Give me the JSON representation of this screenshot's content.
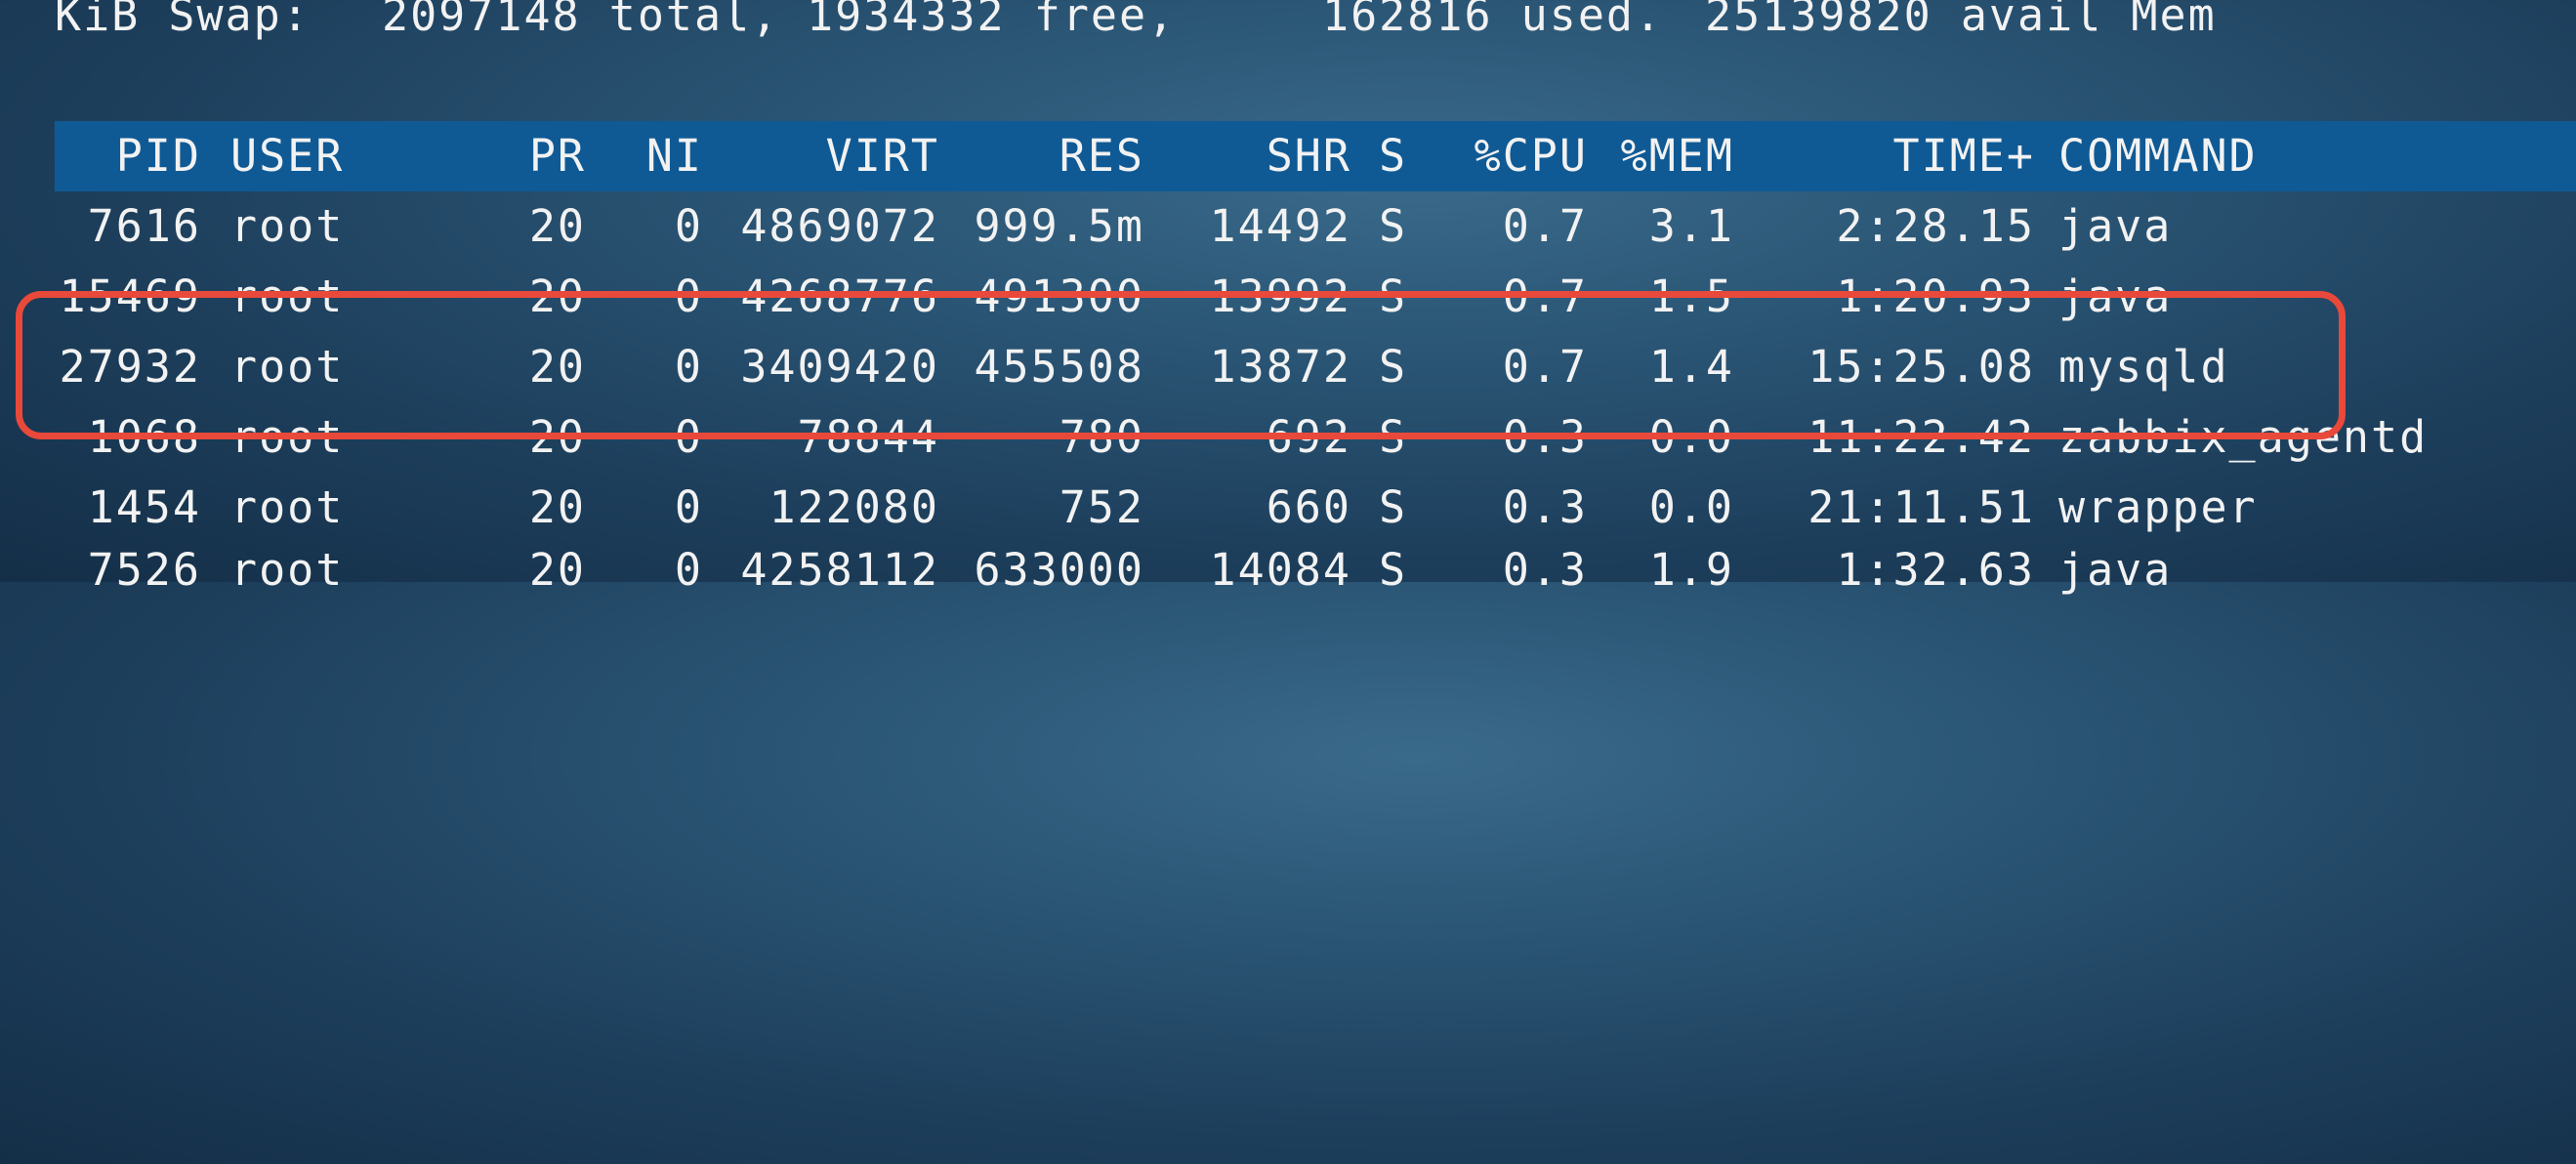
{
  "swap": {
    "label": "KiB Swap:",
    "total": "2097148 total,",
    "free": "1934332 free,",
    "used": "162816 used.",
    "avail": "25139820 avail Mem"
  },
  "header": {
    "pid": "PID",
    "user": "USER",
    "pr": "PR",
    "ni": "NI",
    "virt": "VIRT",
    "res": "RES",
    "shr": "SHR",
    "s": "S",
    "cpu": "%CPU",
    "mem": "%MEM",
    "time": "TIME+",
    "command": "COMMAND"
  },
  "processes": [
    {
      "pid": "7616",
      "user": "root",
      "pr": "20",
      "ni": "0",
      "virt": "4869072",
      "res": "999.5m",
      "shr": "14492",
      "s": "S",
      "cpu": "0.7",
      "mem": "3.1",
      "time": "2:28.15",
      "command": "java"
    },
    {
      "pid": "15469",
      "user": "root",
      "pr": "20",
      "ni": "0",
      "virt": "4268776",
      "res": "491300",
      "shr": "13992",
      "s": "S",
      "cpu": "0.7",
      "mem": "1.5",
      "time": "1:20.93",
      "command": "java"
    },
    {
      "pid": "27932",
      "user": "root",
      "pr": "20",
      "ni": "0",
      "virt": "3409420",
      "res": "455508",
      "shr": "13872",
      "s": "S",
      "cpu": "0.7",
      "mem": "1.4",
      "time": "15:25.08",
      "command": "mysqld"
    },
    {
      "pid": "1068",
      "user": "root",
      "pr": "20",
      "ni": "0",
      "virt": "78844",
      "res": "780",
      "shr": "692",
      "s": "S",
      "cpu": "0.3",
      "mem": "0.0",
      "time": "11:22.42",
      "command": "zabbix_agentd"
    },
    {
      "pid": "1454",
      "user": "root",
      "pr": "20",
      "ni": "0",
      "virt": "122080",
      "res": "752",
      "shr": "660",
      "s": "S",
      "cpu": "0.3",
      "mem": "0.0",
      "time": "21:11.51",
      "command": "wrapper"
    },
    {
      "pid": "7526",
      "user": "root",
      "pr": "20",
      "ni": "0",
      "virt": "4258112",
      "res": "633000",
      "shr": "14084",
      "s": "S",
      "cpu": "0.3",
      "mem": "1.9",
      "time": "1:32.63",
      "command": "java"
    }
  ],
  "colors": {
    "header_bg": "#0f5a95",
    "highlight": "#e8493a",
    "text": "#f2f2f2"
  }
}
